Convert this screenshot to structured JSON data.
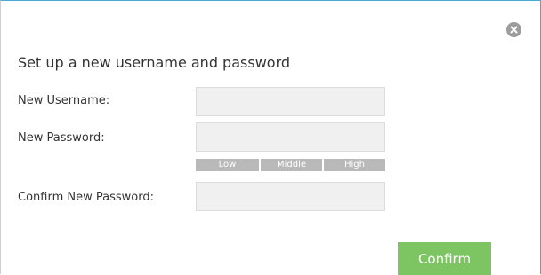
{
  "dialog": {
    "title": "Set up a new username and password",
    "close_icon": "close-circle-icon"
  },
  "form": {
    "username": {
      "label": "New Username:",
      "value": "",
      "placeholder": ""
    },
    "password": {
      "label": "New Password:",
      "value": "",
      "placeholder": ""
    },
    "strength": {
      "levels": [
        "Low",
        "Middle",
        "High"
      ]
    },
    "confirm_password": {
      "label": "Confirm New Password:",
      "value": "",
      "placeholder": ""
    }
  },
  "actions": {
    "confirm_label": "Confirm"
  },
  "colors": {
    "accent_border": "#4aa9d6",
    "confirm_button": "#7dc462",
    "field_background": "#f0f0f0",
    "strength_bar": "#b9b9b9"
  }
}
